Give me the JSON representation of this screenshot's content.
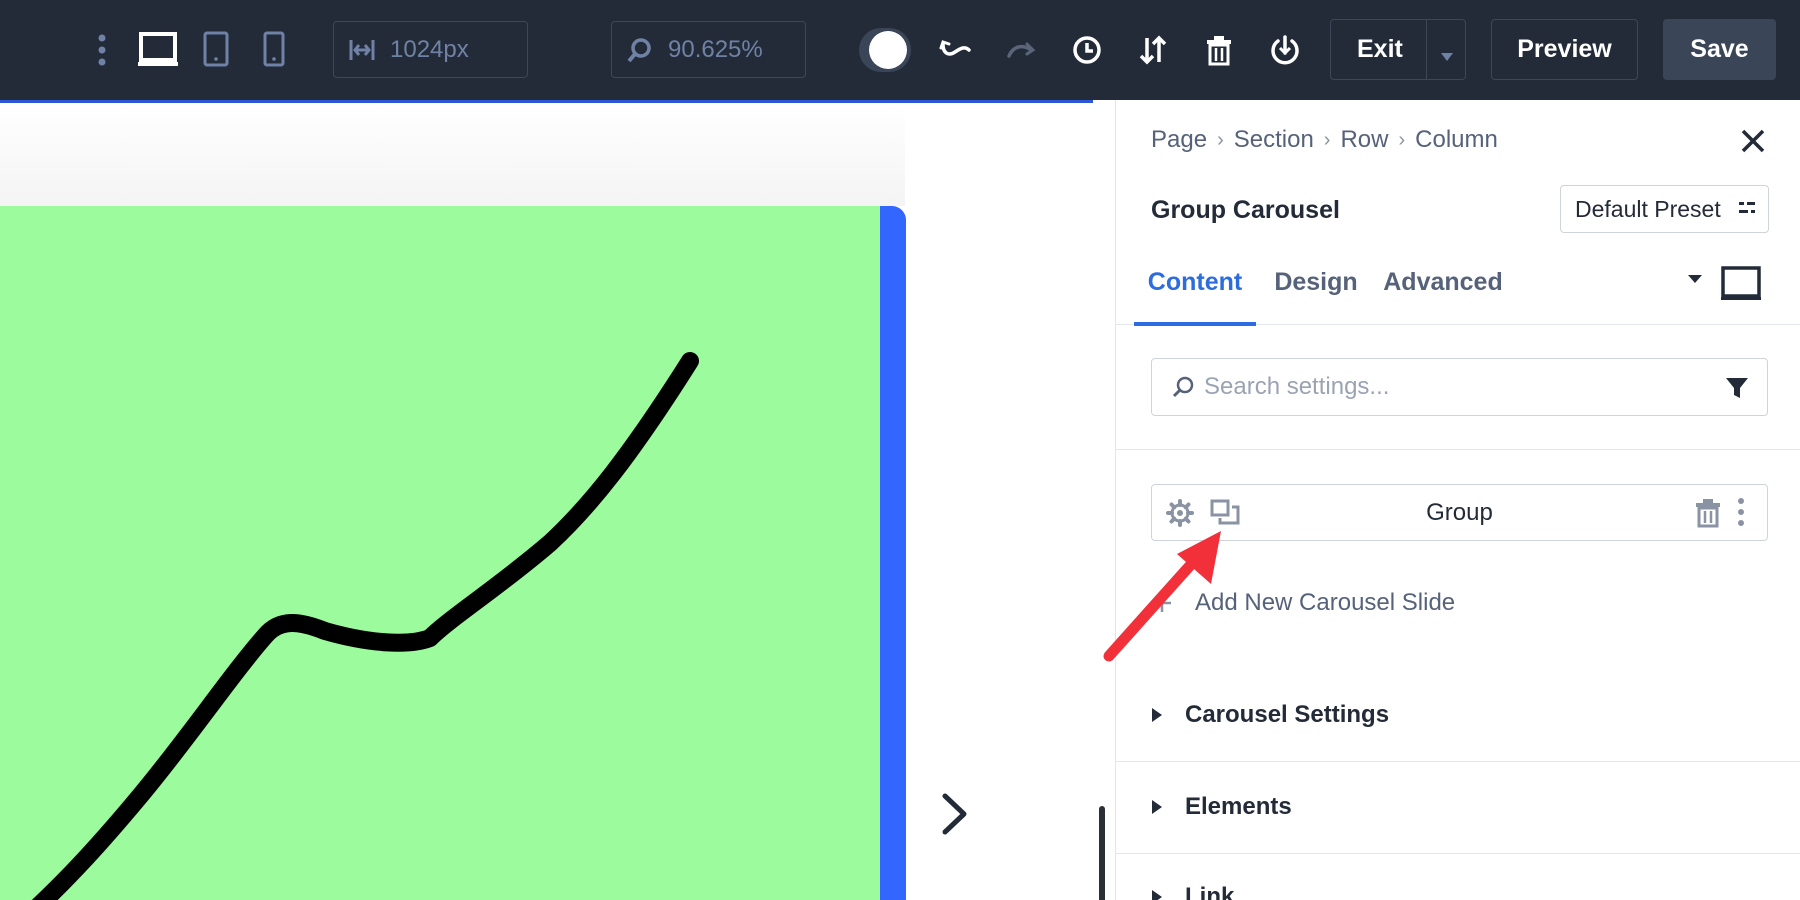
{
  "toolbar": {
    "width_field_value": "1024px",
    "zoom_field_value": "90.625%",
    "exit_label": "Exit",
    "preview_label": "Preview",
    "save_label": "Save"
  },
  "panel": {
    "breadcrumb": [
      "Page",
      "Section",
      "Row",
      "Column"
    ],
    "module_title": "Group Carousel",
    "preset_label": "Default Preset",
    "tabs": [
      {
        "label": "Content",
        "active": true
      },
      {
        "label": "Design",
        "active": false
      },
      {
        "label": "Advanced",
        "active": false
      }
    ],
    "search_placeholder": "Search settings...",
    "group_item_label": "Group",
    "add_slide_label": "Add New Carousel Slide",
    "sections": [
      "Carousel Settings",
      "Elements",
      "Link"
    ]
  },
  "colors": {
    "toolbar_bg": "#232b38",
    "accent": "#2c6ce0",
    "slide_bg": "#9cfb9c",
    "slide_edge": "#3366ff",
    "annotation_arrow": "#f2303a"
  },
  "icons": {
    "toolbar": [
      "more-vertical-icon",
      "desktop-icon",
      "tablet-icon",
      "phone-icon",
      "width-icon",
      "zoom-icon",
      "theme-toggle-icon",
      "undo-icon",
      "redo-icon",
      "history-icon",
      "sort-icon",
      "trash-icon",
      "power-icon",
      "chevron-down-icon"
    ],
    "panel": [
      "close-icon",
      "preset-icon",
      "caret-icon",
      "desktop-icon",
      "search-icon",
      "filter-icon",
      "gear-icon",
      "duplicate-icon",
      "trash-icon",
      "kebab-icon",
      "plus-icon",
      "triangle-right-icon"
    ]
  }
}
